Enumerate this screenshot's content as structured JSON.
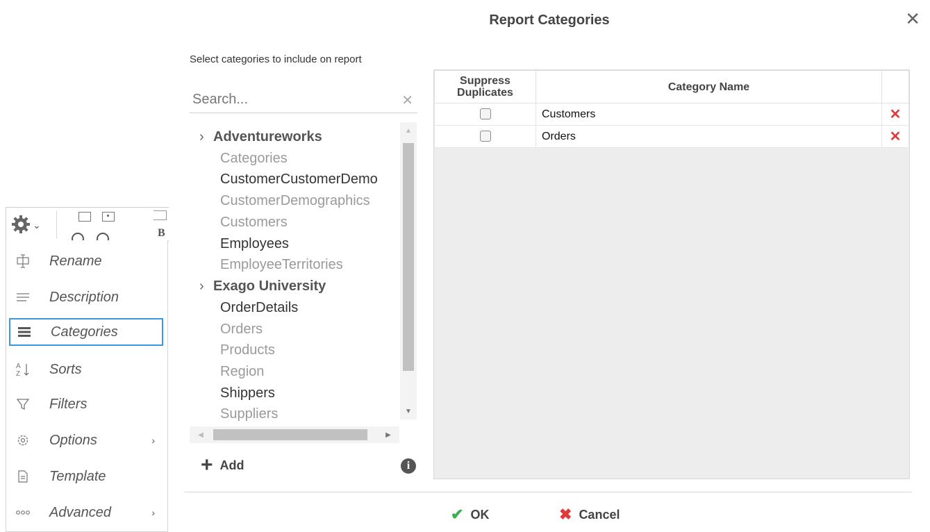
{
  "menu": {
    "items": [
      {
        "label": "Rename",
        "icon": "rename-icon"
      },
      {
        "label": "Description",
        "icon": "description-icon"
      },
      {
        "label": "Categories",
        "icon": "categories-icon",
        "selected": true
      },
      {
        "label": "Sorts",
        "icon": "sort-az-icon"
      },
      {
        "label": "Filters",
        "icon": "filter-icon"
      },
      {
        "label": "Options",
        "icon": "options-gear-icon",
        "has_submenu": true
      },
      {
        "label": "Template",
        "icon": "template-icon"
      },
      {
        "label": "Advanced",
        "icon": "advanced-dots-icon",
        "has_submenu": true
      }
    ],
    "toolbar_letter": "B"
  },
  "dialog": {
    "title": "Report Categories",
    "close_glyph": "✕",
    "instructions": "Select categories to include on report",
    "search": {
      "placeholder": "Search...",
      "clear_glyph": "✕"
    },
    "tree": [
      {
        "type": "group",
        "label": "Adventureworks",
        "caret": "›"
      },
      {
        "type": "leaf",
        "label": "Categories",
        "dim": true
      },
      {
        "type": "leaf",
        "label": "CustomerCustomerDemo",
        "dim": false
      },
      {
        "type": "leaf",
        "label": "CustomerDemographics",
        "dim": true
      },
      {
        "type": "leaf",
        "label": "Customers",
        "dim": true
      },
      {
        "type": "leaf",
        "label": "Employees",
        "dim": false
      },
      {
        "type": "leaf",
        "label": "EmployeeTerritories",
        "dim": true
      },
      {
        "type": "group",
        "label": "Exago University",
        "caret": "›"
      },
      {
        "type": "leaf",
        "label": "OrderDetails",
        "dim": false
      },
      {
        "type": "leaf",
        "label": "Orders",
        "dim": true
      },
      {
        "type": "leaf",
        "label": "Products",
        "dim": true
      },
      {
        "type": "leaf",
        "label": "Region",
        "dim": true
      },
      {
        "type": "leaf",
        "label": "Shippers",
        "dim": false
      },
      {
        "type": "leaf",
        "label": "Suppliers",
        "dim": true
      }
    ],
    "add_label": "Add",
    "grid": {
      "headers": {
        "suppress_line1": "Suppress",
        "suppress_line2": "Duplicates",
        "name": "Category Name"
      },
      "rows": [
        {
          "suppress": false,
          "name": "Customers"
        },
        {
          "suppress": false,
          "name": "Orders"
        }
      ],
      "delete_glyph": "✕"
    },
    "ok_label": "OK",
    "cancel_label": "Cancel",
    "colors": {
      "ok": "#3cb04c",
      "delete": "#e03a3a",
      "selection": "#3b98e0"
    }
  }
}
